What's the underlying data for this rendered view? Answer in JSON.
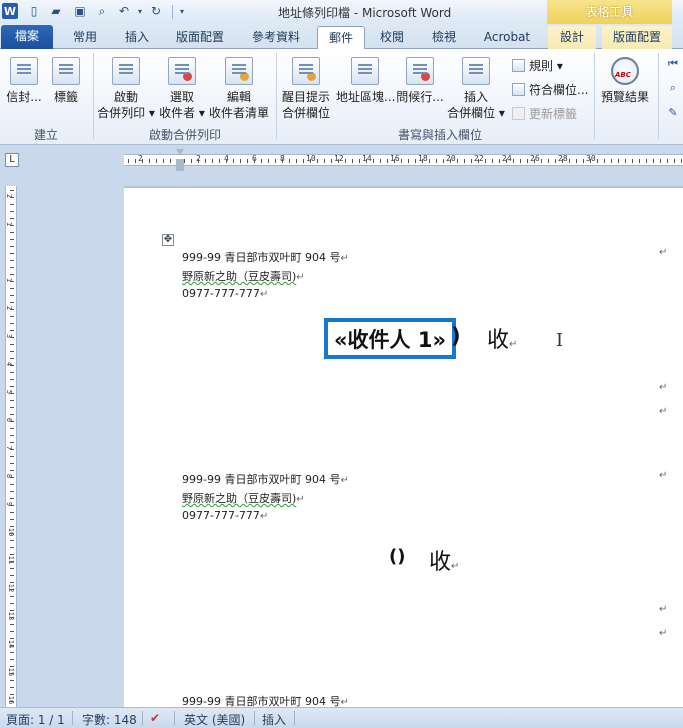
{
  "window": {
    "title": "地址條列印檔 - Microsoft Word",
    "context_header": "表格工具",
    "word_logo": "W"
  },
  "quick_access": {
    "icons": [
      "new-document-icon",
      "open-folder-icon",
      "save-icon",
      "print-preview-icon",
      "undo-icon",
      "redo-icon",
      "customize-dropdown-icon"
    ]
  },
  "tabs": {
    "file": "檔案",
    "items": [
      "常用",
      "插入",
      "版面配置",
      "參考資料",
      "郵件",
      "校閱",
      "檢視",
      "Acrobat",
      "設計",
      "版面配置"
    ],
    "active": "郵件"
  },
  "ribbon": {
    "create": {
      "envelopes": "信封...",
      "labels": "標籤",
      "group": "建立"
    },
    "start_merge": {
      "start": [
        "啟動",
        "合併列印"
      ],
      "select": [
        "選取",
        "收件者"
      ],
      "edit": [
        "編輯",
        "收件者清單"
      ],
      "group": "啟動合併列印"
    },
    "write_insert": {
      "highlight": [
        "醒目提示",
        "合併欄位"
      ],
      "address_block": "地址區塊...",
      "greeting": "問候行...",
      "insert_field": [
        "插入",
        "合併欄位"
      ],
      "rules": "規則",
      "match_fields": "符合欄位...",
      "update_labels": "更新標籤",
      "group": "書寫與插入欄位"
    },
    "preview": {
      "preview_results": "預覽結果"
    }
  },
  "ruler": {
    "tab_selector": "L",
    "h_numbers": [
      "2",
      "2",
      "4",
      "6",
      "8",
      "10",
      "12",
      "14",
      "16",
      "18",
      "20",
      "22",
      "24",
      "26",
      "28",
      "30"
    ],
    "v_numbers": [
      "2",
      "1",
      "1",
      "2",
      "3",
      "4",
      "5",
      "6",
      "7",
      "8",
      "9",
      "10",
      "11",
      "12",
      "13",
      "14",
      "15",
      "16",
      "17",
      "18"
    ]
  },
  "document": {
    "blocks": [
      {
        "address": "999-99  青日部市双叶町 904 号",
        "name": "野原新之助（豆皮壽司)",
        "phone": "0977-777-777",
        "recipient_field": "«收件人 1»",
        "recipient_suffix": ")",
        "shou": "收"
      },
      {
        "address": "999-99  青日部市双叶町 904 号",
        "name": "野原新之助（豆皮壽司)",
        "phone": "0977-777-777",
        "recipient_field": "()",
        "shou": "收"
      },
      {
        "address": "999-99  青日部市双叶町 904 号"
      }
    ],
    "paragraph_mark": "↵",
    "table_move_handle": "✥",
    "cursor": "I"
  },
  "status": {
    "page": "頁面: 1 / 1",
    "words": "字數: 148",
    "language": "英文 (美國)",
    "mode": "插入"
  }
}
